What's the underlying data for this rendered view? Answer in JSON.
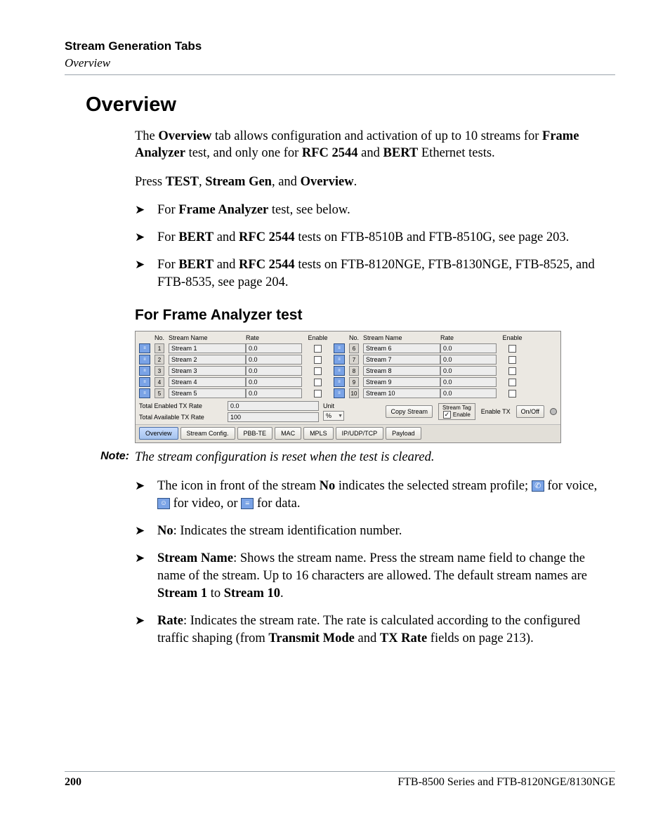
{
  "header": {
    "chapter": "Stream Generation Tabs",
    "section": "Overview"
  },
  "title": "Overview",
  "intro": {
    "p1_pre": "The ",
    "b1": "Overview",
    "p1_mid": " tab allows configuration and activation of up to 10 streams for ",
    "b2": "Frame Analyzer",
    "p1_mid2": " test, and only one for ",
    "b3": "RFC 2544",
    "p1_and": " and ",
    "b4": "BERT",
    "p1_end": " Ethernet tests.",
    "p2_pre": "Press ",
    "p2_b1": "TEST",
    "p2_c1": ", ",
    "p2_b2": "Stream Gen",
    "p2_c2": ", and ",
    "p2_b3": "Overview",
    "p2_end": "."
  },
  "top_bullets": {
    "a_pre": "For ",
    "a_b": "Frame Analyzer",
    "a_post": " test, see below.",
    "b_pre": "For ",
    "b_b1": "BERT",
    "b_and": " and ",
    "b_b2": "RFC 2544",
    "b_post": " tests on FTB-8510B and FTB-8510G, see page 203.",
    "c_pre": "For ",
    "c_b1": "BERT",
    "c_and": " and ",
    "c_b2": "RFC 2544",
    "c_post": " tests on FTB-8120NGE, FTB-8130NGE, FTB-8525, and FTB-8535, see page 204."
  },
  "subheading": "For Frame Analyzer test",
  "shot": {
    "headers": {
      "no": "No.",
      "name": "Stream Name",
      "rate": "Rate",
      "enable": "Enable"
    },
    "streams": [
      {
        "no": "1",
        "name": "Stream 1",
        "rate": "0.0"
      },
      {
        "no": "2",
        "name": "Stream 2",
        "rate": "0.0"
      },
      {
        "no": "3",
        "name": "Stream 3",
        "rate": "0.0"
      },
      {
        "no": "4",
        "name": "Stream 4",
        "rate": "0.0"
      },
      {
        "no": "5",
        "name": "Stream 5",
        "rate": "0.0"
      },
      {
        "no": "6",
        "name": "Stream 6",
        "rate": "0.0"
      },
      {
        "no": "7",
        "name": "Stream 7",
        "rate": "0.0"
      },
      {
        "no": "8",
        "name": "Stream 8",
        "rate": "0.0"
      },
      {
        "no": "9",
        "name": "Stream 9",
        "rate": "0.0"
      },
      {
        "no": "10",
        "name": "Stream 10",
        "rate": "0.0"
      }
    ],
    "totals": {
      "enabled_lbl": "Total Enabled TX Rate",
      "enabled_val": "0.0",
      "available_lbl": "Total Available TX Rate",
      "available_val": "100",
      "unit_lbl": "Unit",
      "unit_val": "%"
    },
    "controls": {
      "copy": "Copy Stream",
      "tag_title": "Stream Tag",
      "tag_enable": "Enable",
      "enable_tx": "Enable TX",
      "onoff": "On/Off"
    },
    "tabs": [
      "Overview",
      "Stream Config.",
      "PBB-TE",
      "MAC",
      "MPLS",
      "IP/UDP/TCP",
      "Payload"
    ]
  },
  "note": {
    "label": "Note:",
    "text": "The stream configuration is reset when the test is cleared."
  },
  "desc_bullets": {
    "icon_pre": "The icon in front of the stream ",
    "icon_b": "No",
    "icon_mid": " indicates the selected stream profile; ",
    "voice_txt": " for voice, ",
    "video_txt": " for video, or ",
    "data_txt": " for data.",
    "no_b": "No",
    "no_txt": ": Indicates the stream identification number.",
    "name_b": "Stream Name",
    "name_txt_1": ": Shows the stream name. Press the stream name field to change the name of the stream. Up to 16 characters are allowed. The default stream names are ",
    "name_b2": "Stream 1",
    "name_to": " to ",
    "name_b3": "Stream 10",
    "name_end": ".",
    "rate_b": "Rate",
    "rate_txt_1": ": Indicates the stream rate. The rate is calculated according to the configured traffic shaping (from ",
    "rate_b2": "Transmit Mode",
    "rate_and": " and ",
    "rate_b3": "TX Rate",
    "rate_txt_2": " fields on page 213)."
  },
  "footer": {
    "page": "200",
    "doc": "FTB-8500 Series and FTB-8120NGE/8130NGE"
  }
}
